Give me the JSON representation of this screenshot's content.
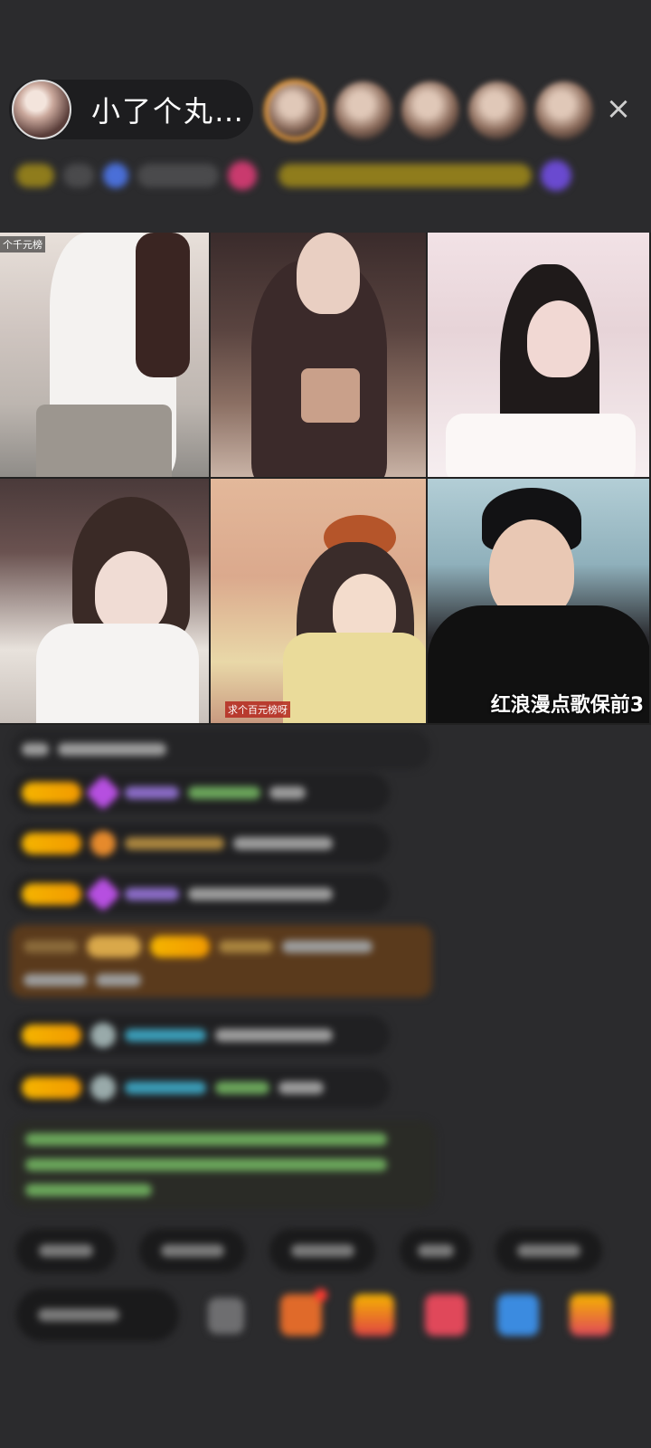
{
  "header": {
    "host_name": "小了个丸…",
    "close_icon": "×"
  },
  "tiles": [
    {
      "caption": "个千元榜",
      "title": ""
    },
    {
      "caption": "",
      "title": ""
    },
    {
      "caption": "",
      "title": ""
    },
    {
      "caption": "",
      "title": ""
    },
    {
      "caption": "求个百元榜呀",
      "title": ""
    },
    {
      "caption": "",
      "title": "红浪漫点歌保前3"
    }
  ],
  "colors": {
    "background": "#2b2b2d",
    "badge_gold": "#f5b400",
    "notification_red": "#ff3b30"
  },
  "icons": [
    "close-icon",
    "gift-icon",
    "chat-icon",
    "emoji-icon"
  ]
}
